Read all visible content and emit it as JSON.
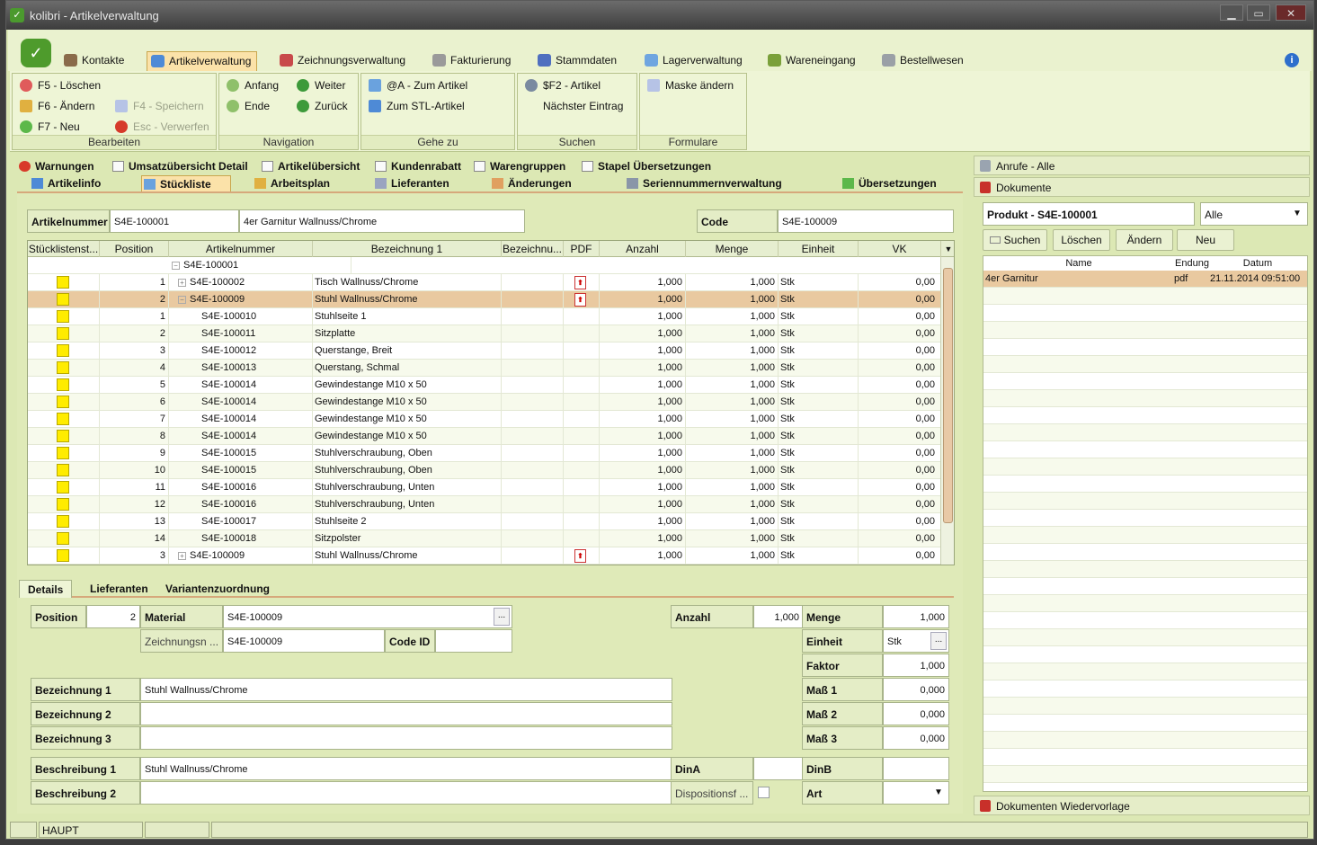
{
  "window": {
    "title": "kolibri - Artikelverwaltung",
    "min": "▁",
    "max": "▭",
    "close": "✕"
  },
  "menu": {
    "tabs": [
      {
        "label": "Kontakte",
        "icon": "contacts-icon",
        "color": "#8a6b4a"
      },
      {
        "label": "Artikelverwaltung",
        "icon": "article-icon",
        "color": "#4e8ad6"
      },
      {
        "label": "Zeichnungsverwaltung",
        "icon": "drawing-icon",
        "color": "#c84a4a"
      },
      {
        "label": "Fakturierung",
        "icon": "invoice-icon",
        "color": "#9a9a9a"
      },
      {
        "label": "Stammdaten",
        "icon": "master-data-icon",
        "color": "#4f6fbf"
      },
      {
        "label": "Lagerverwaltung",
        "icon": "warehouse-icon",
        "color": "#6fa6e0"
      },
      {
        "label": "Wareneingang",
        "icon": "goods-receipt-icon",
        "color": "#7aa03a"
      },
      {
        "label": "Bestellwesen",
        "icon": "ordering-icon",
        "color": "#9aa0a6"
      }
    ],
    "info": "i"
  },
  "ribbon": {
    "bearbeiten": {
      "label": "Bearbeiten",
      "items": [
        "F5 - Löschen",
        "F6 - Ändern",
        "F7 - Neu",
        "F4 - Speichern",
        "Esc - Verwerfen"
      ]
    },
    "navigation": {
      "label": "Navigation",
      "items": [
        "Anfang",
        "Weiter",
        "Ende",
        "Zurück"
      ]
    },
    "gehezu": {
      "label": "Gehe zu",
      "items": [
        "@A - Zum Artikel",
        "Zum STL-Artikel"
      ]
    },
    "suchen": {
      "label": "Suchen",
      "items": [
        "$F2 - Artikel",
        "Nächster Eintrag"
      ]
    },
    "formulare": {
      "label": "Formulare",
      "items": [
        "Maske ändern"
      ]
    }
  },
  "subtabs_row1": [
    "Warnungen",
    "Umsatzübersicht Detail",
    "Artikelübersicht",
    "Kundenrabatt",
    "Warengruppen",
    "Stapel Übersetzungen"
  ],
  "subtabs_row2": [
    "Artikelinfo",
    "Stückliste",
    "Arbeitsplan",
    "Lieferanten",
    "Änderungen",
    "Seriennummernverwaltung",
    "Übersetzungen"
  ],
  "header_fields": {
    "artikelnummer_label": "Artikelnummer",
    "artikelnummer": "S4E-100001",
    "bezeichnung": "4er Garnitur Wallnuss/Chrome",
    "code_label": "Code",
    "code": "S4E-100009"
  },
  "grid": {
    "columns": [
      "Stücklistenst...",
      "Position",
      "Artikelnummer",
      "Bezeichnung 1",
      "Bezeichnu...",
      "PDF",
      "Anzahl",
      "Menge",
      "Einheit",
      "VK"
    ],
    "root": "S4E-100001",
    "rows": [
      {
        "pos": "1",
        "art": "S4E-100002",
        "bez": "Tisch Wallnuss/Chrome",
        "pdf": true,
        "anzahl": "1,000",
        "menge": "1,000",
        "einheit": "Stk",
        "vk": "0,00",
        "level": 1,
        "tree": "+"
      },
      {
        "pos": "2",
        "art": "S4E-100009",
        "bez": "Stuhl Wallnuss/Chrome",
        "pdf": true,
        "anzahl": "1,000",
        "menge": "1,000",
        "einheit": "Stk",
        "vk": "0,00",
        "level": 1,
        "tree": "−",
        "selected": true
      },
      {
        "pos": "1",
        "art": "S4E-100010",
        "bez": "Stuhlseite 1",
        "anzahl": "1,000",
        "menge": "1,000",
        "einheit": "Stk",
        "vk": "0,00",
        "level": 2
      },
      {
        "pos": "2",
        "art": "S4E-100011",
        "bez": "Sitzplatte",
        "anzahl": "1,000",
        "menge": "1,000",
        "einheit": "Stk",
        "vk": "0,00",
        "level": 2
      },
      {
        "pos": "3",
        "art": "S4E-100012",
        "bez": "Querstange, Breit",
        "anzahl": "1,000",
        "menge": "1,000",
        "einheit": "Stk",
        "vk": "0,00",
        "level": 2
      },
      {
        "pos": "4",
        "art": "S4E-100013",
        "bez": "Querstang, Schmal",
        "anzahl": "1,000",
        "menge": "1,000",
        "einheit": "Stk",
        "vk": "0,00",
        "level": 2
      },
      {
        "pos": "5",
        "art": "S4E-100014",
        "bez": "Gewindestange M10 x 50",
        "anzahl": "1,000",
        "menge": "1,000",
        "einheit": "Stk",
        "vk": "0,00",
        "level": 2
      },
      {
        "pos": "6",
        "art": "S4E-100014",
        "bez": "Gewindestange M10 x 50",
        "anzahl": "1,000",
        "menge": "1,000",
        "einheit": "Stk",
        "vk": "0,00",
        "level": 2
      },
      {
        "pos": "7",
        "art": "S4E-100014",
        "bez": "Gewindestange M10 x 50",
        "anzahl": "1,000",
        "menge": "1,000",
        "einheit": "Stk",
        "vk": "0,00",
        "level": 2
      },
      {
        "pos": "8",
        "art": "S4E-100014",
        "bez": "Gewindestange M10 x 50",
        "anzahl": "1,000",
        "menge": "1,000",
        "einheit": "Stk",
        "vk": "0,00",
        "level": 2
      },
      {
        "pos": "9",
        "art": "S4E-100015",
        "bez": "Stuhlverschraubung, Oben",
        "anzahl": "1,000",
        "menge": "1,000",
        "einheit": "Stk",
        "vk": "0,00",
        "level": 2
      },
      {
        "pos": "10",
        "art": "S4E-100015",
        "bez": "Stuhlverschraubung, Oben",
        "anzahl": "1,000",
        "menge": "1,000",
        "einheit": "Stk",
        "vk": "0,00",
        "level": 2
      },
      {
        "pos": "11",
        "art": "S4E-100016",
        "bez": "Stuhlverschraubung, Unten",
        "anzahl": "1,000",
        "menge": "1,000",
        "einheit": "Stk",
        "vk": "0,00",
        "level": 2
      },
      {
        "pos": "12",
        "art": "S4E-100016",
        "bez": "Stuhlverschraubung, Unten",
        "anzahl": "1,000",
        "menge": "1,000",
        "einheit": "Stk",
        "vk": "0,00",
        "level": 2
      },
      {
        "pos": "13",
        "art": "S4E-100017",
        "bez": "Stuhlseite 2",
        "anzahl": "1,000",
        "menge": "1,000",
        "einheit": "Stk",
        "vk": "0,00",
        "level": 2
      },
      {
        "pos": "14",
        "art": "S4E-100018",
        "bez": "Sitzpolster",
        "anzahl": "1,000",
        "menge": "1,000",
        "einheit": "Stk",
        "vk": "0,00",
        "level": 2
      },
      {
        "pos": "3",
        "art": "S4E-100009",
        "bez": "Stuhl Wallnuss/Chrome",
        "pdf": true,
        "anzahl": "1,000",
        "menge": "1,000",
        "einheit": "Stk",
        "vk": "0,00",
        "level": 1,
        "tree": "+"
      }
    ],
    "status_color": "#ffec00",
    "pdf_glyph": "PDF"
  },
  "detail_tabs": [
    "Details",
    "Lieferanten",
    "Variantenzuordnung"
  ],
  "details": {
    "position_label": "Position",
    "position": "2",
    "material_label": "Material",
    "material": "S4E-100009",
    "zeichnung_label": "Zeichnungsn ...",
    "zeichnung": "S4E-100009",
    "codeid_label": "Code ID",
    "codeid": "",
    "anzahl_label": "Anzahl",
    "anzahl": "1,000",
    "menge_label": "Menge",
    "menge": "1,000",
    "einheit_label": "Einheit",
    "einheit": "Stk",
    "faktor_label": "Faktor",
    "faktor": "1,000",
    "mass1_label": "Maß 1",
    "mass1": "0,000",
    "mass2_label": "Maß 2",
    "mass2": "0,000",
    "mass3_label": "Maß 3",
    "mass3": "0,000",
    "bez1_label": "Bezeichnung 1",
    "bez1": "Stuhl Wallnuss/Chrome",
    "bez2_label": "Bezeichnung 2",
    "bez2": "",
    "bez3_label": "Bezeichnung 3",
    "bez3": "",
    "besch1_label": "Beschreibung 1",
    "besch1": "Stuhl Wallnuss/Chrome",
    "besch2_label": "Beschreibung 2",
    "besch2": "",
    "dina_label": "DinA",
    "dina": "",
    "dinb_label": "DinB",
    "dinb": "",
    "dispo_label": "Dispositionsf ...",
    "art_label": "Art",
    "art": "",
    "ellipsis": "...",
    "dropdown": "▼"
  },
  "right": {
    "anrufe": "Anrufe - Alle",
    "dokumente": "Dokumente",
    "produkt": "Produkt - S4E-100001",
    "filter": "Alle",
    "buttons": [
      "Suchen",
      "Löschen",
      "Ändern",
      "Neu"
    ],
    "columns": [
      "Name",
      "Endung",
      "Datum"
    ],
    "docs": [
      {
        "name": "4er Garnitur",
        "ext": "pdf",
        "date": "21.11.2014 09:51:00"
      }
    ],
    "wiedervorlage": "Dokumenten Wiedervorlage"
  },
  "statusbar": {
    "mode": "HAUPT"
  }
}
